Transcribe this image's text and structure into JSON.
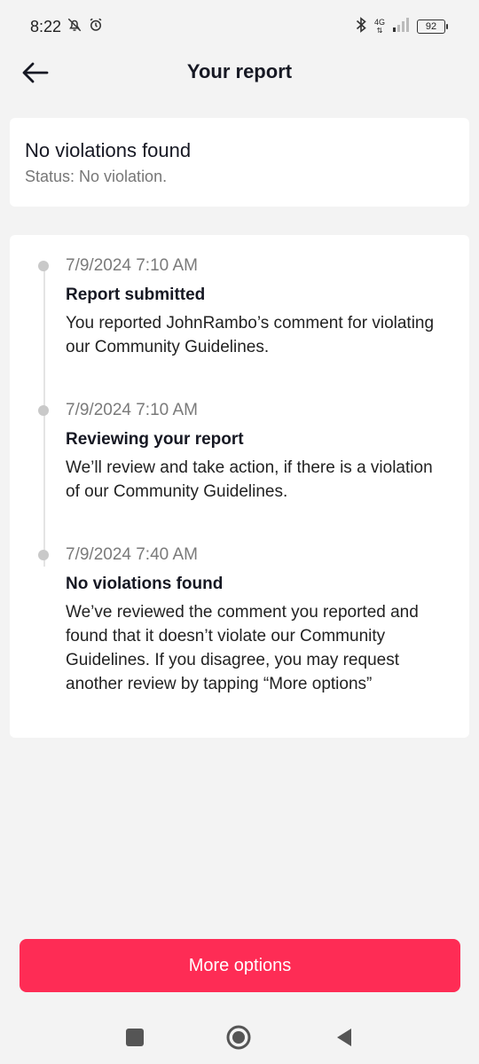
{
  "status_bar": {
    "time": "8:22",
    "network": "4G",
    "battery": "92"
  },
  "header": {
    "title": "Your report"
  },
  "status_card": {
    "title": "No violations found",
    "subtitle": "Status: No violation."
  },
  "timeline": [
    {
      "date": "7/9/2024 7:10 AM",
      "title": "Report submitted",
      "description": "You reported JohnRambo’s comment for violating our Community Guidelines."
    },
    {
      "date": "7/9/2024 7:10 AM",
      "title": "Reviewing your report",
      "description": "We’ll review and take action, if there is a violation of our Community Guidelines."
    },
    {
      "date": "7/9/2024 7:40 AM",
      "title": "No violations found",
      "description": "We’ve reviewed the comment you reported and found that it doesn’t violate our Community Guidelines. If you disagree, you may request another review by tapping “More options”"
    }
  ],
  "actions": {
    "more_options_label": "More options"
  },
  "colors": {
    "accent": "#fe2c55",
    "background": "#f3f3f3"
  }
}
